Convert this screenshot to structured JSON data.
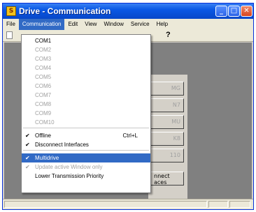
{
  "window": {
    "title": "Drive - Communication",
    "app_icon": "S"
  },
  "title_buttons": {
    "minimize_glyph": "_",
    "maximize_glyph": "□",
    "close_glyph": "✕"
  },
  "menubar": [
    "File",
    "Communication",
    "Edit",
    "View",
    "Window",
    "Service",
    "Help"
  ],
  "toolbar": {
    "help_glyph": "?"
  },
  "communication_menu": {
    "ports": [
      "COM1",
      "COM2",
      "COM3",
      "COM4",
      "COM5",
      "COM6",
      "COM7",
      "COM8",
      "COM9",
      "COM10"
    ],
    "offline": {
      "label": "Offline",
      "shortcut": "Ctrl+L",
      "checked": true
    },
    "disconnect": {
      "label": "Disconnect Interfaces",
      "checked": true
    },
    "multidrive": {
      "label": "Multidrive",
      "checked": true
    },
    "update_active": {
      "label": "Update active Window only",
      "checked": true,
      "disabled": true
    },
    "lower_priority": {
      "label": "Lower Transmission Priority"
    },
    "check_glyph": "✔"
  },
  "background_buttons": [
    "MG",
    "N7",
    "MU",
    "K8",
    "110",
    "nnect",
    "aces"
  ]
}
